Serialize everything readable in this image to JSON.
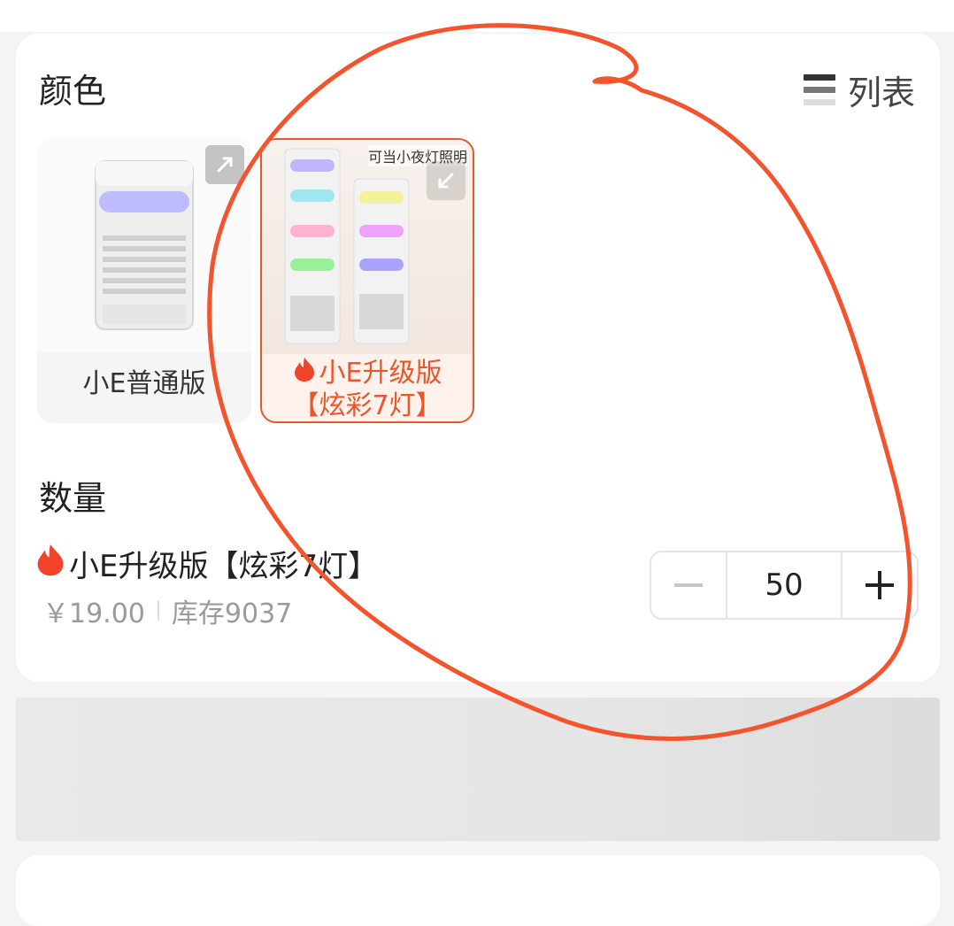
{
  "color_section": {
    "title": "颜色",
    "view_toggle_label": "列表",
    "options": [
      {
        "label": "小E普通版",
        "selected": false
      },
      {
        "label_line1": "小E升级版",
        "label_line2": "【炫彩7灯】",
        "tagline": "可当小夜灯照明",
        "selected": true
      }
    ]
  },
  "quantity_section": {
    "title": "数量",
    "product_name": "小E升级版【炫彩7灯】",
    "price": "￥19.00",
    "stock": "库存9037",
    "quantity": "50"
  },
  "colors": {
    "accent": "#e8572a",
    "annotation": "#f2542d"
  },
  "icons": [
    "list-view-icon",
    "expand-icon",
    "fire-icon",
    "minus-icon",
    "plus-icon"
  ]
}
